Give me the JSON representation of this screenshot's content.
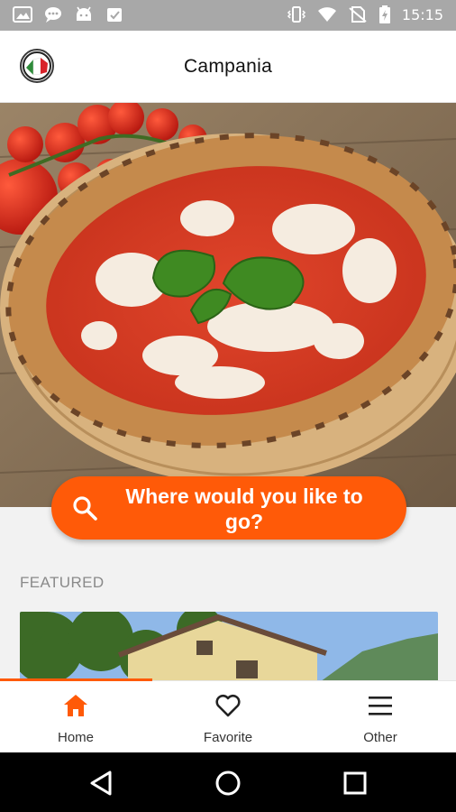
{
  "status_bar": {
    "time": "15:15",
    "left_icons": [
      "gallery-icon",
      "chat-icon",
      "android-icon",
      "clipboard-check-icon"
    ],
    "right_icons": [
      "vibrate-icon",
      "wifi-icon",
      "no-sim-icon",
      "battery-charging-icon"
    ]
  },
  "app_bar": {
    "title": "Campania",
    "logo_icon": "italy-flag-badge-icon"
  },
  "hero": {
    "image": "margherita-pizza-photo"
  },
  "search": {
    "label": "Where would you like to go?",
    "icon": "search-icon"
  },
  "featured": {
    "heading": "FEATURED",
    "card_image": "house-with-mountains-photo"
  },
  "bottom_nav": {
    "active": "Home",
    "items": [
      {
        "label": "Home",
        "icon": "home-icon"
      },
      {
        "label": "Favorite",
        "icon": "heart-icon"
      },
      {
        "label": "Other",
        "icon": "menu-icon"
      }
    ]
  },
  "system_nav": [
    "back-icon",
    "home-circle-icon",
    "recents-icon"
  ],
  "colors": {
    "accent": "#ff5a08",
    "status_bar": "#a8a8a8",
    "background": "#f2f2f2"
  }
}
